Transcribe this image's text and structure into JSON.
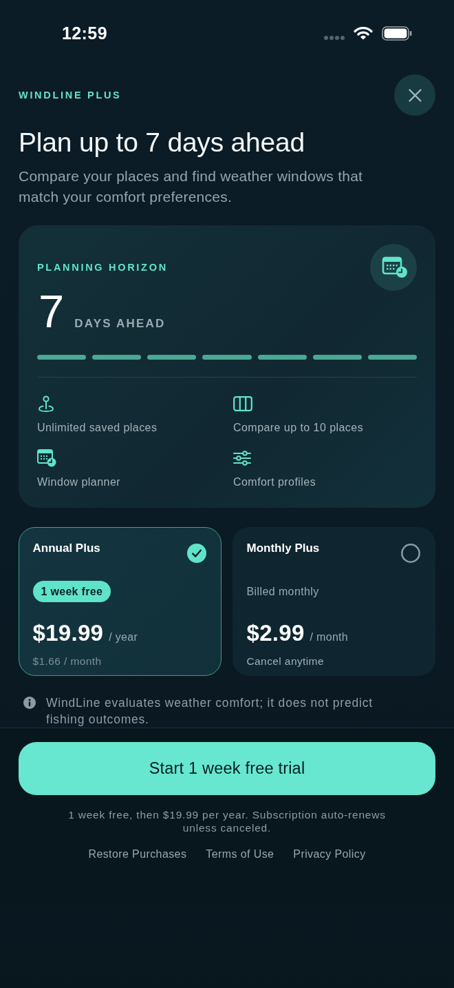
{
  "status_bar": {
    "time": "12:59"
  },
  "header": {
    "eyebrow": "WINDLINE PLUS",
    "title": "Plan up to 7 days ahead",
    "subtitle": "Compare your places and find weather windows that match your comfort preferences."
  },
  "horizon": {
    "label": "PLANNING HORIZON",
    "value": "7",
    "unit": "DAYS AHEAD",
    "segments": [
      {
        "filled": true
      },
      {
        "filled": true
      },
      {
        "filled": true
      },
      {
        "filled": true
      },
      {
        "filled": true
      },
      {
        "filled": true
      },
      {
        "filled": true
      }
    ],
    "features": [
      {
        "kind": "pin",
        "label": "Unlimited saved places"
      },
      {
        "kind": "columns",
        "label": "Compare up to 10 places"
      },
      {
        "kind": "calendar",
        "label": "Window planner"
      },
      {
        "kind": "sliders",
        "label": "Comfort profiles"
      }
    ]
  },
  "plans": [
    {
      "name": "Annual Plus",
      "selected": true,
      "badge": "1 week free",
      "price": "$19.99",
      "period": "/ year",
      "note": "$1.66 / month"
    },
    {
      "name": "Monthly Plus",
      "selected": false,
      "subtitle": "Billed monthly",
      "price": "$2.99",
      "period": "/ month",
      "note": "Cancel anytime"
    }
  ],
  "info": {
    "text": "WindLine evaluates weather comfort; it does not predict fishing outcomes."
  },
  "footer": {
    "cta": "Start 1 week free trial",
    "legal": "1 week free, then $19.99 per year. Subscription auto-renews unless canceled.",
    "links": [
      "Restore Purchases",
      "Terms of Use",
      "Privacy Policy"
    ]
  }
}
